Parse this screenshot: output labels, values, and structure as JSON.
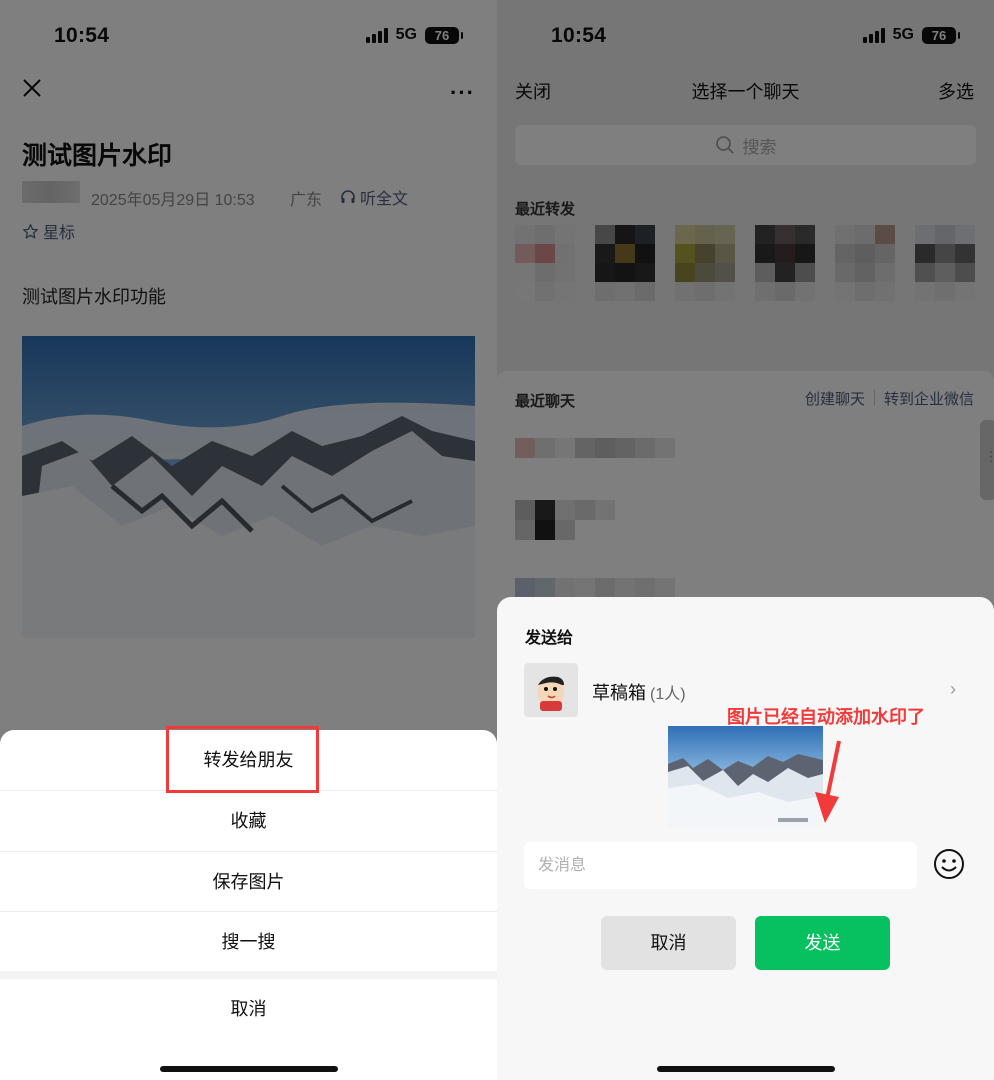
{
  "left": {
    "status": {
      "time": "10:54",
      "network": "5G",
      "battery": "76"
    },
    "article": {
      "title": "测试图片水印",
      "date": "2025年05月29日 10:53",
      "region": "广东",
      "listen_label": "听全文",
      "star_label": "星标",
      "body": "测试图片水印功能"
    },
    "action_sheet": {
      "items": [
        "转发给朋友",
        "收藏",
        "保存图片",
        "搜一搜"
      ],
      "cancel": "取消"
    }
  },
  "right": {
    "status": {
      "time": "10:54",
      "network": "5G",
      "battery": "76"
    },
    "nav": {
      "close": "关闭",
      "title": "选择一个聊天",
      "multi": "多选"
    },
    "search": {
      "placeholder": "搜索"
    },
    "recent_forward_label": "最近转发",
    "recent_chats_label": "最近聊天",
    "create_chat": "创建聊天",
    "to_wecom": "转到企业微信",
    "send_sheet": {
      "title": "发送给",
      "recipient": "草稿箱",
      "recipient_count": "(1人)",
      "annotation": "图片已经自动添加水印了",
      "message_placeholder": "发消息",
      "cancel": "取消",
      "send": "发送"
    }
  },
  "colors": {
    "accent_red": "#f23a3a",
    "wechat_green": "#07c160",
    "link_blue": "#4d5d80"
  }
}
